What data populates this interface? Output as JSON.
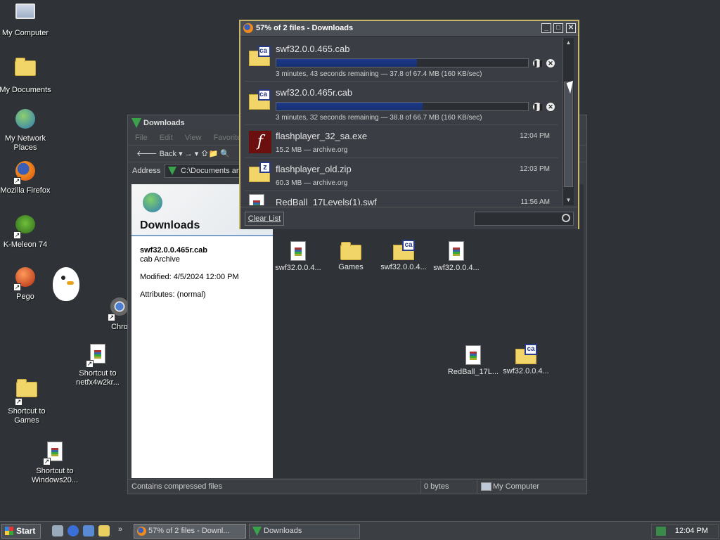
{
  "desktop": {
    "icons": [
      {
        "label": "My Computer"
      },
      {
        "label": "My Documents"
      },
      {
        "label": "My Network Places"
      },
      {
        "label": "Mozilla Firefox"
      },
      {
        "label": "K-Meleon 74"
      },
      {
        "label": "Pego"
      },
      {
        "label": "Chro"
      },
      {
        "label": "Shortcut to netfx4w2kr..."
      },
      {
        "label": "Shortcut to Games"
      },
      {
        "label": "Shortcut to Windows20..."
      }
    ]
  },
  "explorer": {
    "title": "Downloads",
    "menu": [
      "File",
      "Edit",
      "View",
      "Favorites"
    ],
    "toolbar": {
      "back": "Back"
    },
    "address": {
      "label": "Address",
      "value": "C:\\Documents an"
    },
    "left_panel": {
      "title": "Downloads",
      "file_name": "swf32.0.0.465r.cab",
      "file_type": "cab Archive",
      "modified": "Modified: 4/5/2024 12:00 PM",
      "attributes": "Attributes: (normal)"
    },
    "files": [
      {
        "label": "swf32.0.0.4..."
      },
      {
        "label": "Games"
      },
      {
        "label": "swf32.0.0.4..."
      },
      {
        "label": "swf32.0.0.4..."
      },
      {
        "label": "RedBall_17L..."
      },
      {
        "label": "swf32.0.0.4..."
      }
    ],
    "status": {
      "text": "Contains compressed files",
      "size": "0 bytes",
      "location": "My Computer"
    }
  },
  "downloads": {
    "title": "57% of 2 files - Downloads",
    "items": [
      {
        "name": "swf32.0.0.465.cab",
        "progress": 0.56,
        "meta": "3 minutes, 43 seconds remaining — 37.8 of 67.4 MB (160 KB/sec)"
      },
      {
        "name": "swf32.0.0.465r.cab",
        "progress": 0.58,
        "meta": "3 minutes, 32 seconds remaining — 38.8 of 66.7 MB (160 KB/sec)"
      },
      {
        "name": "flashplayer_32_sa.exe",
        "meta": "15.2 MB — archive.org",
        "time": "12:04 PM"
      },
      {
        "name": "flashplayer_old.zip",
        "meta": "60.3 MB — archive.org",
        "time": "12:03 PM"
      },
      {
        "name": "RedBall_17Levels(1).swf",
        "time": "11:56 AM"
      }
    ],
    "clear_list": "Clear List",
    "search_placeholder": ""
  },
  "taskbar": {
    "start": "Start",
    "buttons": [
      {
        "label": "57% of 2 files - Downl..."
      },
      {
        "label": "Downloads"
      }
    ],
    "clock": "12:04 PM"
  }
}
